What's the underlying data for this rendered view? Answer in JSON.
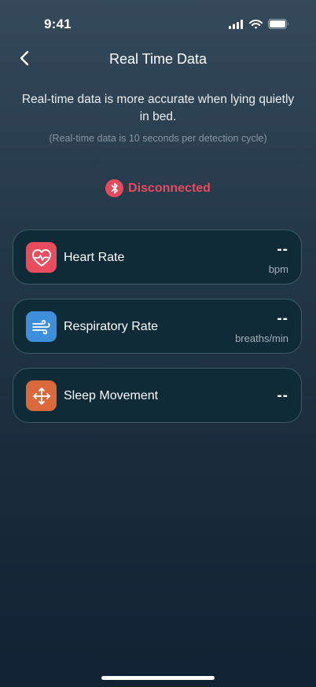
{
  "status_bar": {
    "time": "9:41"
  },
  "header": {
    "title": "Real Time Data",
    "back_icon": "chevron-left-icon"
  },
  "hint": {
    "primary": "Real-time data is more accurate when lying quietly in bed.",
    "secondary": "(Real-time data is 10 seconds per detection cycle)"
  },
  "connection": {
    "status": "Disconnected",
    "icon": "bluetooth-icon",
    "color": "#e54b5d"
  },
  "metrics": [
    {
      "label": "Heart Rate",
      "value": "--",
      "unit": "bpm",
      "icon": "heart-rate-icon",
      "color": "#e84c5d"
    },
    {
      "label": "Respiratory Rate",
      "value": "--",
      "unit": "breaths/min",
      "icon": "wind-icon",
      "color": "#3d8fdc"
    },
    {
      "label": "Sleep Movement",
      "value": "--",
      "unit": "",
      "icon": "move-arrows-icon",
      "color": "#d9683a"
    }
  ]
}
